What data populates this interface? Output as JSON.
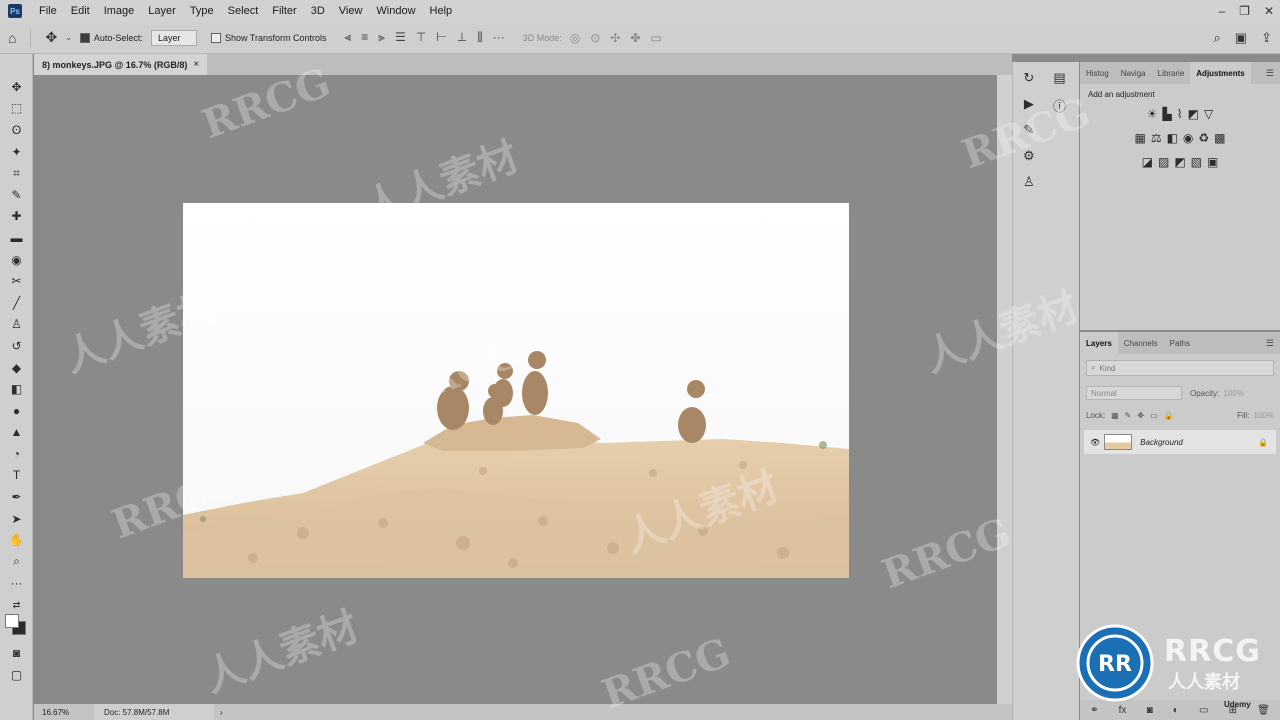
{
  "app": {
    "logo_text": "Ps"
  },
  "menu": [
    "File",
    "Edit",
    "Image",
    "Layer",
    "Type",
    "Select",
    "Filter",
    "3D",
    "View",
    "Window",
    "Help"
  ],
  "window_controls": [
    "–",
    "❐",
    "✕"
  ],
  "options_bar": {
    "auto_select_label": "Auto-Select:",
    "auto_select_value": "Layer",
    "show_transform_label": "Show Transform Controls",
    "mode_3d_label": "3D Mode:"
  },
  "document": {
    "tab_title": "8) monkeys.JPG @ 16.7% (RGB/8)",
    "tab_close": "×"
  },
  "status": {
    "zoom": "16.67%",
    "doc_size": "Doc: 57.8M/57.8M",
    "arrow": "›"
  },
  "adjustments_panel": {
    "tabs": [
      "Histog",
      "Naviga",
      "Librarie",
      "Adjustments"
    ],
    "active_tab": 3,
    "hint": "Add an adjustment"
  },
  "layers_panel": {
    "tabs": [
      "Layers",
      "Channels",
      "Paths"
    ],
    "active_tab": 0,
    "kind_placeholder": "Kind",
    "blend_mode": "Normal",
    "opacity_label": "Opacity:",
    "opacity_value": "100%",
    "lock_label": "Lock:",
    "fill_label": "Fill:",
    "fill_value": "100%",
    "layers": [
      {
        "name": "Background",
        "visible": true,
        "locked": true
      }
    ]
  },
  "branding": {
    "logo": "RRCG",
    "sub": "人人素材",
    "udemy": "Udemy"
  },
  "watermarks": [
    "RRCG",
    "人人素材"
  ],
  "colors": {
    "foreground": "#ffffff",
    "background": "#2a2a2a",
    "accent_brand": "#1a6fb5"
  }
}
